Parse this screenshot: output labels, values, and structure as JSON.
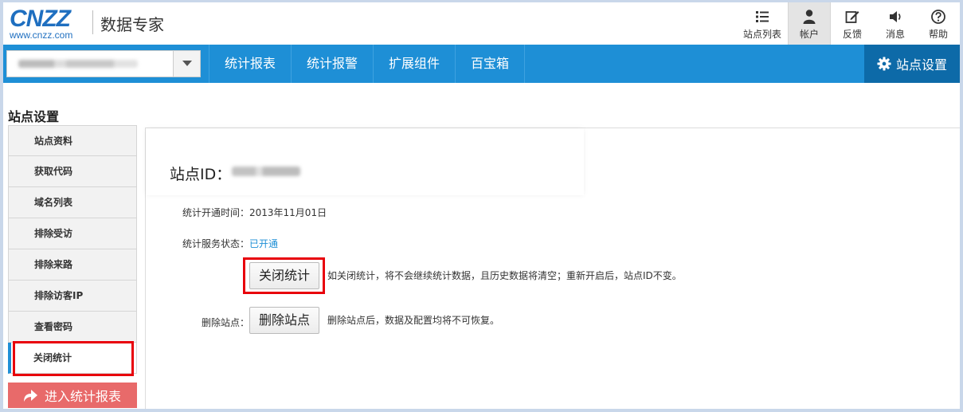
{
  "header": {
    "logo_text": "CNZZ",
    "logo_url": "www.cnzz.com",
    "app_title": "数据专家",
    "icons": [
      {
        "label": "站点列表",
        "icon": "list-icon"
      },
      {
        "label": "帐户",
        "icon": "user-icon"
      },
      {
        "label": "反馈",
        "icon": "edit-icon"
      },
      {
        "label": "消息",
        "icon": "speaker-icon"
      },
      {
        "label": "帮助",
        "icon": "help-icon"
      }
    ]
  },
  "nav": {
    "items": [
      "统计报表",
      "统计报警",
      "扩展组件",
      "百宝箱"
    ],
    "settings_label": "站点设置"
  },
  "page_title": "站点设置",
  "sidebar": {
    "items": [
      "站点资料",
      "获取代码",
      "域名列表",
      "排除受访",
      "排除来路",
      "排除访客IP",
      "查看密码",
      "关闭统计"
    ],
    "active_index": 7,
    "enter_report": "进入统计报表"
  },
  "main": {
    "site_id_label": "站点ID：",
    "open_time": "统计开通时间：2013年11月01日",
    "service_status_label": "统计服务状态：",
    "service_status_value": "已开通",
    "close_button": "关闭统计",
    "close_note": "如关闭统计，将不会继续统计数据，且历史数据将清空；重新开启后，站点ID不变。",
    "delete_label": "删除站点：",
    "delete_button": "删除站点",
    "delete_note": "删除站点后，数据及配置均将不可恢复。"
  },
  "colors": {
    "brand_blue": "#1e8fd6",
    "highlight_red": "#e8000b",
    "enter_button": "#e86a6a"
  }
}
